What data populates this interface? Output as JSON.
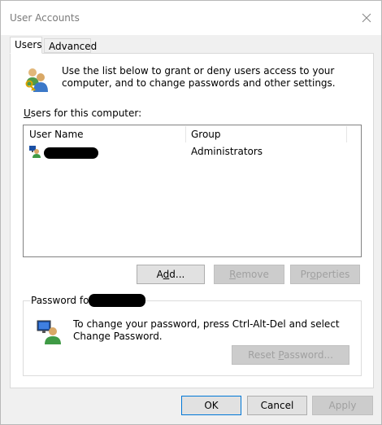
{
  "window": {
    "title": "User Accounts",
    "close_icon": "close-icon"
  },
  "tabs": [
    {
      "label": "Users",
      "active": true
    },
    {
      "label": "Advanced",
      "active": false
    }
  ],
  "intro": {
    "icon": "users-key-icon",
    "text": "Use the list below to grant or deny users access to your computer, and to change passwords and other settings."
  },
  "users_section": {
    "label_underlined": "U",
    "label_rest": "sers for this computer:",
    "columns": [
      "User Name",
      "Group"
    ],
    "rows": [
      {
        "user_name": "",
        "user_icon": "user-account-icon",
        "group": "Administrators"
      }
    ]
  },
  "user_buttons": {
    "add": {
      "pre": "A",
      "u": "d",
      "post": "d..."
    },
    "remove": {
      "u": "R",
      "post": "emove"
    },
    "properties": {
      "pre": "Pr",
      "u": "o",
      "post": "perties"
    }
  },
  "password_group": {
    "legend": "Password for",
    "icon": "user-password-icon",
    "text": "To change your password, press Ctrl-Alt-Del and select Change Password.",
    "reset": {
      "pre": "Reset ",
      "u": "P",
      "post": "assword..."
    }
  },
  "dialog_buttons": {
    "ok": "OK",
    "cancel": "Cancel",
    "apply": "Apply"
  },
  "colors": {
    "title_text": "#7a7a7a",
    "focus_border": "#0078d7",
    "disabled_text": "#a0a0a0"
  }
}
